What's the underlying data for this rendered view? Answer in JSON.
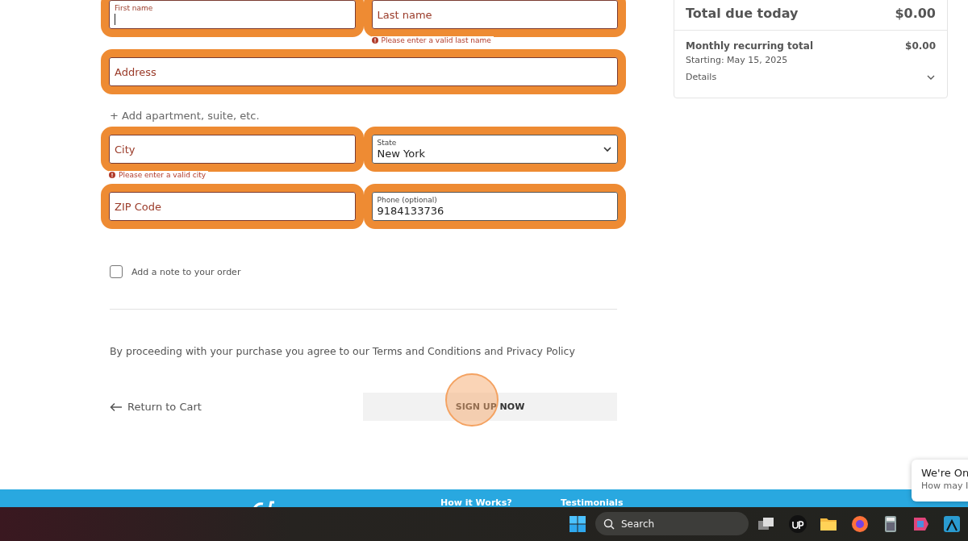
{
  "form": {
    "rows": [
      {
        "fields": [
          {
            "kind": "text",
            "label": "First name",
            "focused": true,
            "highlighted": true,
            "invalid": true
          },
          {
            "kind": "text",
            "placeholder": "Last name",
            "focused": false,
            "highlighted": true,
            "invalid": true,
            "error": "Please enter a valid last name"
          }
        ]
      },
      {
        "fields": [
          {
            "kind": "text",
            "placeholder": "Address",
            "focused": false,
            "highlighted": true,
            "invalid": true
          }
        ]
      },
      {
        "link": "+ Add apartment, suite, etc."
      },
      {
        "fields": [
          {
            "kind": "text",
            "placeholder": "City",
            "focused": false,
            "highlighted": true,
            "invalid": true,
            "error": "Please enter a valid city"
          },
          {
            "kind": "select",
            "label": "State",
            "value": "New York",
            "focused": false,
            "highlighted": true,
            "invalid": false
          }
        ]
      },
      {
        "fields": [
          {
            "kind": "text",
            "placeholder": "ZIP Code",
            "focused": false,
            "highlighted": true,
            "invalid": true
          },
          {
            "kind": "text",
            "label": "Phone (optional)",
            "value": "9184133736",
            "focused": false,
            "highlighted": true,
            "invalid": false
          }
        ]
      }
    ],
    "note_checkbox": {
      "label": "Add a note to your order",
      "checked": false
    },
    "terms": "By proceeding with your purchase you agree to our Terms and Conditions and Privacy Policy",
    "back_link": "Return to Cart",
    "submit": {
      "label": "SIGN UP NOW",
      "click_marker": true
    }
  },
  "summary": {
    "total_label": "Total due today",
    "total": "$0.00",
    "recurring_label": "Monthly recurring total",
    "recurring": "$0.00",
    "starting": "Starting: May 15, 2025",
    "details": "Details",
    "expanded": false
  },
  "footer": {
    "links": [
      "How it Works?",
      "Testimonials"
    ]
  },
  "chat": {
    "title": "We're On",
    "message": "How may I"
  },
  "taskbar": {
    "search": "Search"
  }
}
